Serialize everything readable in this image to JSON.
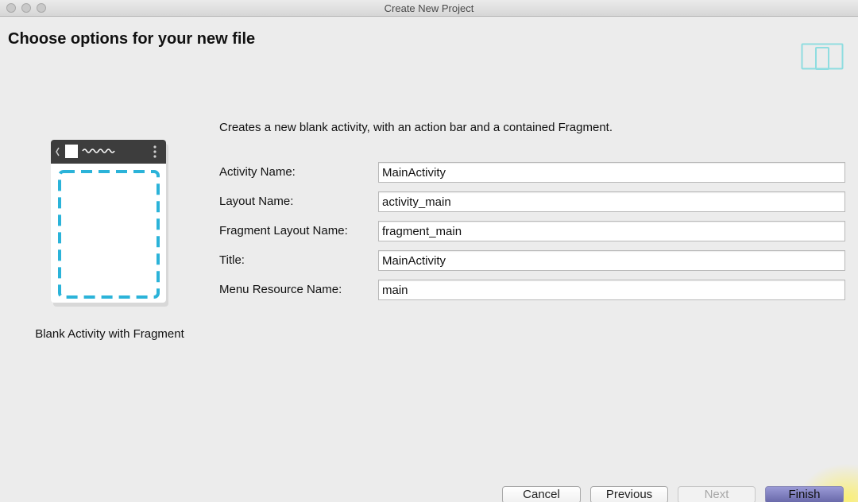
{
  "window": {
    "title": "Create New Project"
  },
  "header": {
    "title": "Choose options for your new file"
  },
  "template": {
    "name": "Blank Activity with Fragment"
  },
  "description": "Creates a new blank activity, with an action bar and a contained Fragment.",
  "form": {
    "fields": [
      {
        "label": "Activity Name:",
        "value": "MainActivity"
      },
      {
        "label": "Layout Name:",
        "value": "activity_main"
      },
      {
        "label": "Fragment Layout Name:",
        "value": "fragment_main"
      },
      {
        "label": "Title:",
        "value": "MainActivity"
      },
      {
        "label": "Menu Resource Name:",
        "value": "main"
      }
    ]
  },
  "buttons": {
    "cancel": "Cancel",
    "previous": "Previous",
    "next": "Next",
    "finish": "Finish"
  },
  "colors": {
    "accent_dashed": "#2bb3d9",
    "device_icon": "#8fdde0",
    "finish_button": "#7b7bbf"
  },
  "icons": {
    "device": "device-outline-icon",
    "preview": "blank-activity-fragment-preview"
  }
}
